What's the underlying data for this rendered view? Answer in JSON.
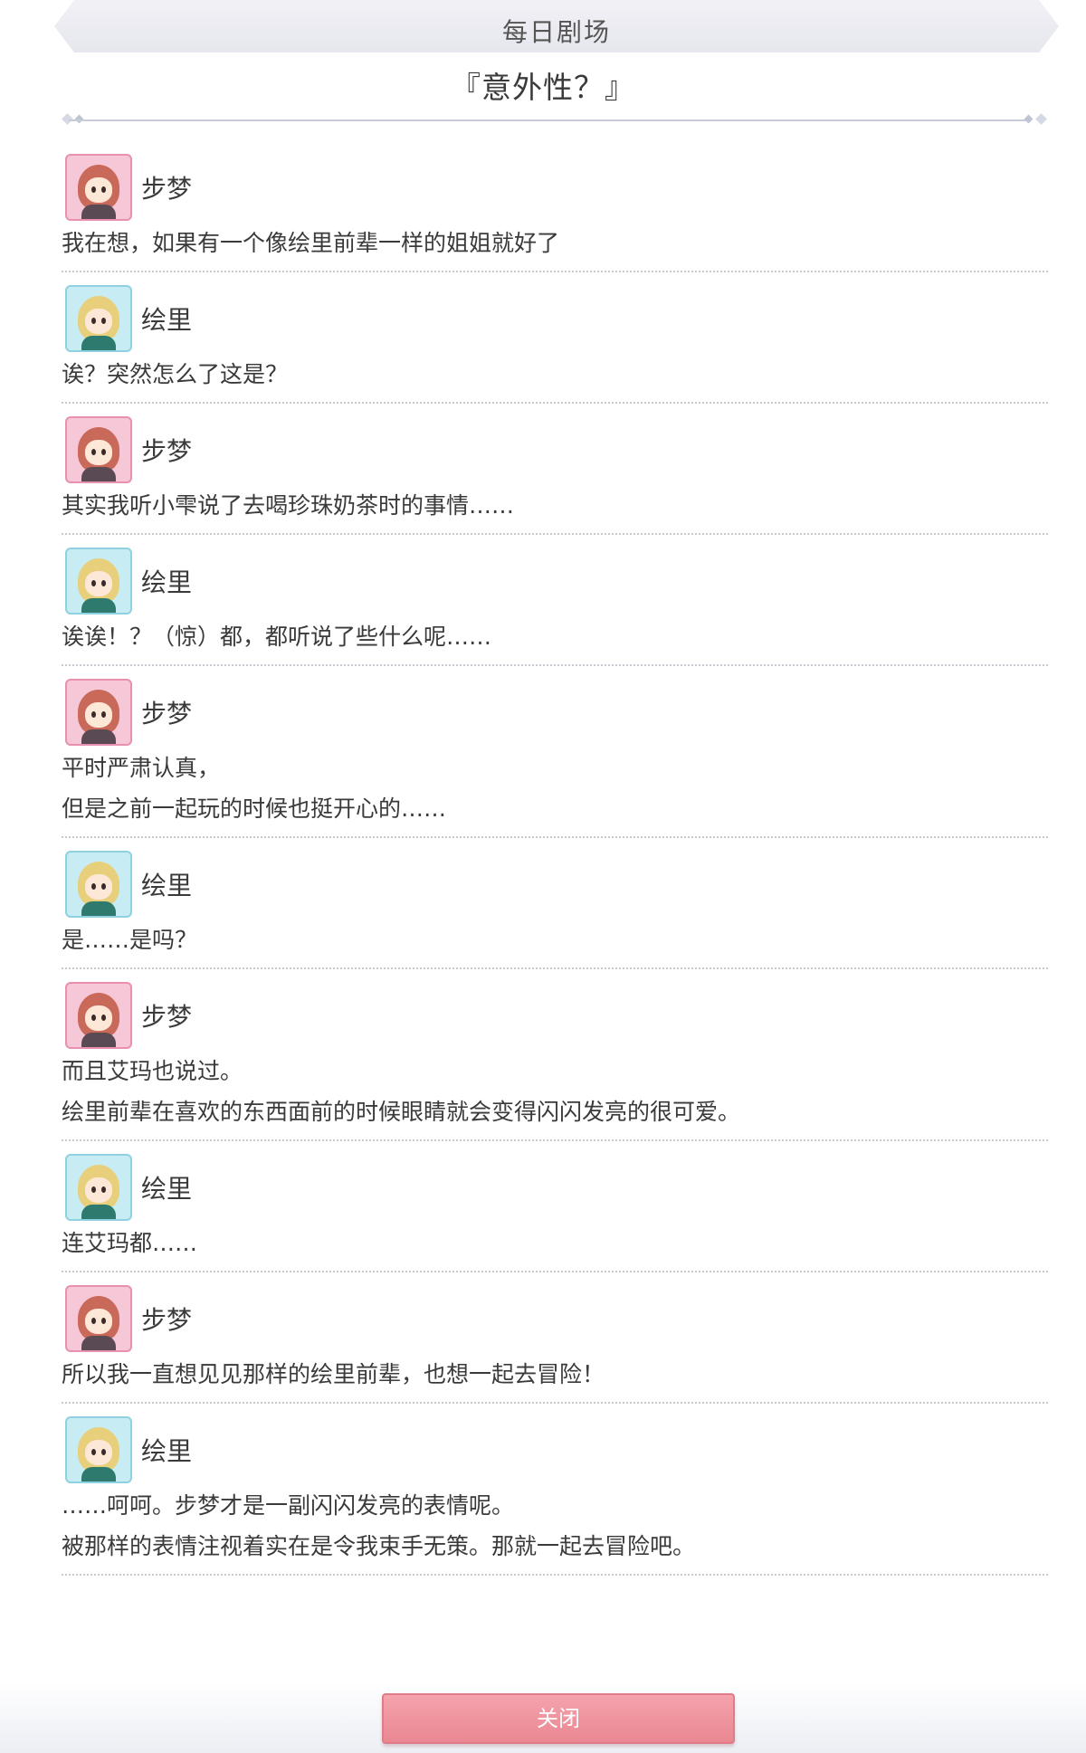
{
  "header": {
    "label": "每日剧场",
    "title": "『意外性？』"
  },
  "messages": [
    {
      "speaker": "步梦",
      "avatar": "ayumu-avatar",
      "lines": [
        "我在想，如果有一个像绘里前辈一样的姐姐就好了"
      ]
    },
    {
      "speaker": "绘里",
      "avatar": "eli-avatar",
      "lines": [
        "诶？突然怎么了这是？"
      ]
    },
    {
      "speaker": "步梦",
      "avatar": "ayumu-avatar",
      "lines": [
        "其实我听小雫说了去喝珍珠奶茶时的事情……"
      ]
    },
    {
      "speaker": "绘里",
      "avatar": "eli-avatar",
      "lines": [
        "诶诶！？（惊）都，都听说了些什么呢……"
      ]
    },
    {
      "speaker": "步梦",
      "avatar": "ayumu-avatar",
      "lines": [
        "平时严肃认真，",
        "但是之前一起玩的时候也挺开心的……"
      ]
    },
    {
      "speaker": "绘里",
      "avatar": "eli-avatar",
      "lines": [
        "是……是吗？"
      ]
    },
    {
      "speaker": "步梦",
      "avatar": "ayumu-avatar",
      "lines": [
        "而且艾玛也说过。",
        "绘里前辈在喜欢的东西面前的时候眼睛就会变得闪闪发亮的很可爱。"
      ]
    },
    {
      "speaker": "绘里",
      "avatar": "eli-avatar",
      "lines": [
        "连艾玛都……"
      ]
    },
    {
      "speaker": "步梦",
      "avatar": "ayumu-avatar",
      "lines": [
        "所以我一直想见见那样的绘里前辈，也想一起去冒险！"
      ]
    },
    {
      "speaker": "绘里",
      "avatar": "eli-avatar",
      "lines": [
        "……呵呵。步梦才是一副闪闪发亮的表情呢。",
        "被那样的表情注视着实在是令我束手无策。那就一起去冒险吧。"
      ]
    }
  ],
  "footer": {
    "close_label": "关闭"
  },
  "colors": {
    "close_button": "#ea8792",
    "ayumu_frame": "#e98fb0",
    "eli_frame": "#8fd1e0"
  }
}
